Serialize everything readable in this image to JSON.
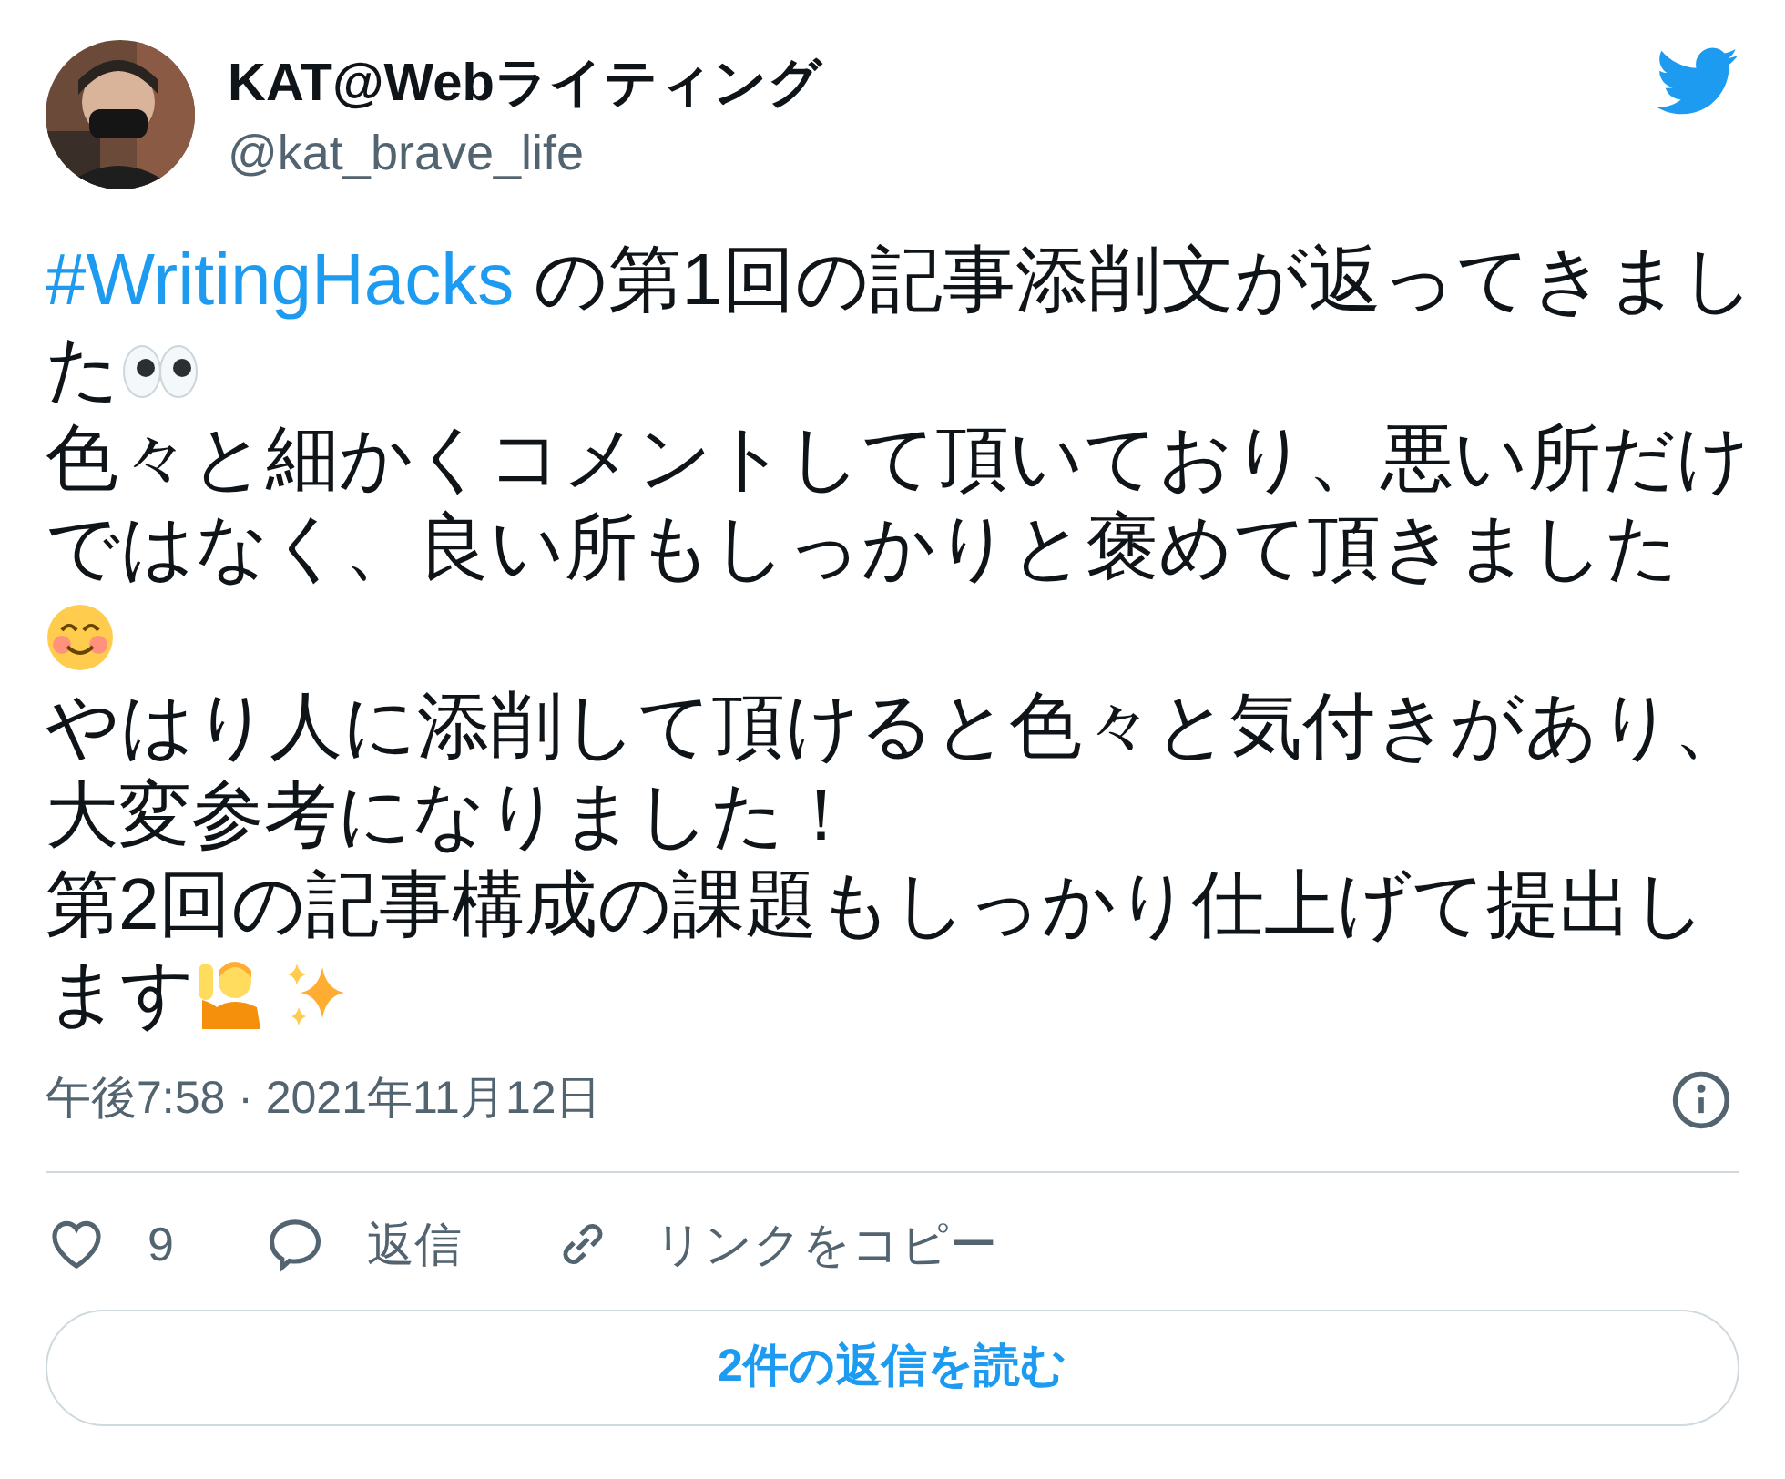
{
  "author": {
    "name": "KAT@Webライティング",
    "handle": "@kat_brave_life"
  },
  "tweet": {
    "lines": [
      [
        {
          "kind": "hashtag",
          "text": "#WritingHacks"
        },
        {
          "kind": "text",
          "text": " の第1回の記事添削文が返ってきまし"
        }
      ],
      [
        {
          "kind": "text",
          "text": "た"
        },
        {
          "kind": "eyes"
        }
      ],
      [
        {
          "kind": "text",
          "text": "色々と細かくコメントして頂いており、悪い所だけ"
        }
      ],
      [
        {
          "kind": "text",
          "text": "ではなく、良い所もしっかりと褒めて頂きました"
        }
      ],
      [
        {
          "kind": "smile"
        }
      ],
      [
        {
          "kind": "text",
          "text": "やはり人に添削して頂けると色々と気付きがあり、"
        }
      ],
      [
        {
          "kind": "text",
          "text": "大変参考になりました！"
        }
      ],
      [
        {
          "kind": "text",
          "text": "第2回の記事構成の課題もしっかり仕上げて提出し"
        }
      ],
      [
        {
          "kind": "text",
          "text": "ます"
        },
        {
          "kind": "raised-hand"
        },
        {
          "kind": "sparkles"
        }
      ]
    ]
  },
  "timestamp": "午後7:58 · 2021年11月12日",
  "actions": [
    {
      "kind": "like",
      "label": "9"
    },
    {
      "kind": "reply",
      "label": "返信"
    },
    {
      "kind": "link",
      "label": "リンクをコピー"
    }
  ],
  "read_replies_button": "2件の返信を読む"
}
